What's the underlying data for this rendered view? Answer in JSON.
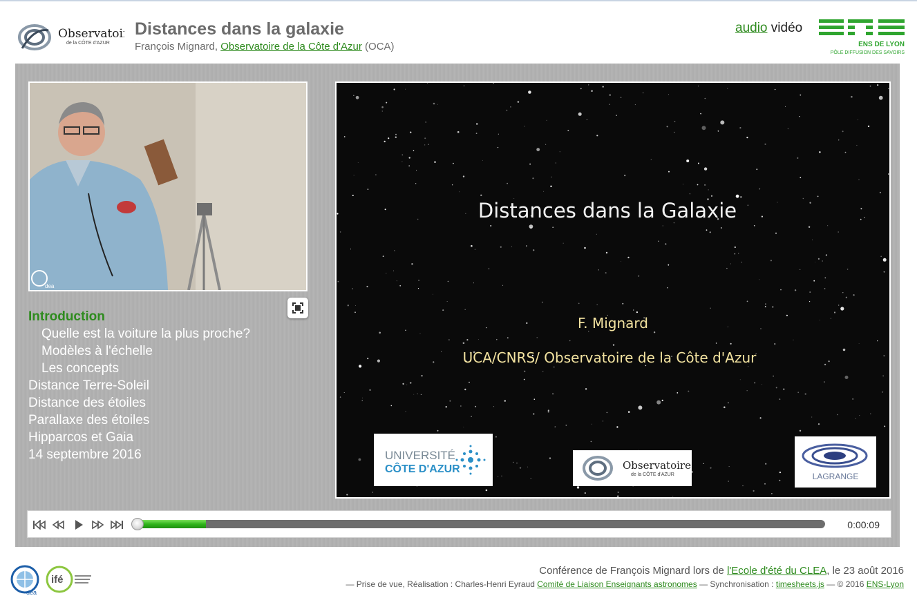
{
  "header": {
    "org_logo_name": "Observatoire",
    "org_logo_sub": "de la CÔTE d'AZUR",
    "title": "Distances dans la galaxie",
    "speaker": "François Mignard,",
    "institution_link": "Observatoire de la Côte d'Azur",
    "institution_abbr": "(OCA)",
    "mode_audio": "audio",
    "mode_video": "vidéo",
    "ens_logo_name": "ENS DE LYON",
    "ens_logo_tagline": "PÔLE DIFFUSION DES SAVOIRS"
  },
  "video": {
    "watermark": "dea"
  },
  "toc": {
    "items": [
      {
        "label": "Introduction",
        "level": 0,
        "active": true
      },
      {
        "label": "Quelle est la voiture la plus proche?",
        "level": 1,
        "active": false
      },
      {
        "label": "Modèles à l'échelle",
        "level": 1,
        "active": false
      },
      {
        "label": "Les concepts",
        "level": 1,
        "active": false
      },
      {
        "label": "Distance Terre-Soleil",
        "level": 0,
        "active": false
      },
      {
        "label": "Distance des étoiles",
        "level": 0,
        "active": false
      },
      {
        "label": "Parallaxe des étoiles",
        "level": 0,
        "active": false
      },
      {
        "label": "Hipparcos et Gaia",
        "level": 0,
        "active": false
      },
      {
        "label": "14 septembre 2016",
        "level": 0,
        "active": false
      }
    ]
  },
  "slide": {
    "title": "Distances dans la Galaxie",
    "author": "F. Mignard",
    "affiliation": "UCA/CNRS/ Observatoire de la Côte d'Azur",
    "logo_uca_line1": "UNIVERSITÉ",
    "logo_uca_line2": "CÔTE D'AZUR",
    "logo_oca_name": "Observatoire",
    "logo_oca_sub": "de la CÔTE d'AZUR",
    "logo_lagrange": "LAGRANGE"
  },
  "player": {
    "current_time": "0:00:09",
    "progress_fraction": 0.1
  },
  "footer": {
    "credit_line_prefix": "Conférence de François Mignard lors de",
    "event_link": "l'Ecole d'été du CLEA",
    "credit_line_suffix": ", le 23 août 2016",
    "production_prefix": "— Prise de vue, Réalisation : Charles-Henri Eyraud",
    "clea_link": "Comité de Liaison Enseignants astronomes",
    "sync_prefix": "— Synchronisation :",
    "timesheets_link": "timesheets.js",
    "copyright_prefix": "— © 2016",
    "ens_link": "ENS-Lyon",
    "logo_dea": "dea",
    "logo_ife": "ifé"
  },
  "colors": {
    "accent_green": "#2e8b1e",
    "panel_gray": "#b3b3b3",
    "title_gray": "#6b6b6b"
  },
  "icons": [
    "observatoire-logo",
    "ens-logo",
    "expand-icon",
    "skip-to-start-icon",
    "rewind-icon",
    "play-icon",
    "fast-forward-icon",
    "skip-to-end-icon"
  ]
}
